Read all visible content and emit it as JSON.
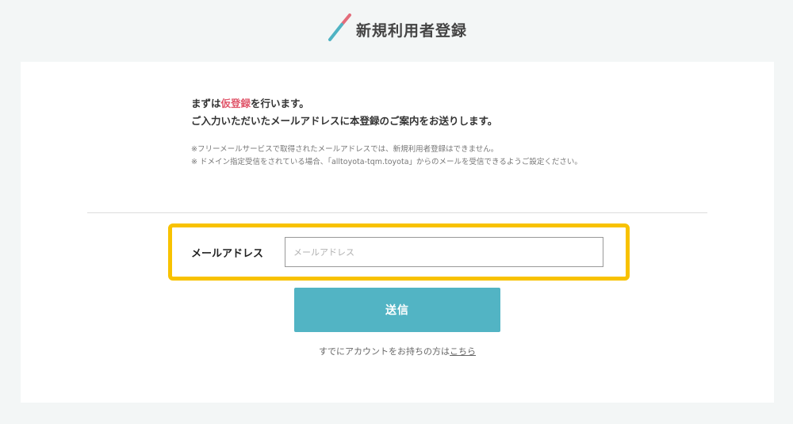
{
  "header": {
    "title": "新規利用者登録",
    "icon": "slash-mark-icon",
    "icon_colors": [
      "#e36c7a",
      "#4fb3c3"
    ]
  },
  "intro": {
    "line1_prefix": "まずは",
    "line1_accent": "仮登録",
    "line1_suffix": "を行います。",
    "line2": "ご入力いただいたメールアドレスに本登録のご案内をお送りします。"
  },
  "notes": [
    "※フリーメールサービスで取得されたメールアドレスでは、新規利用者登録はできません。",
    "※ ドメイン指定受信をされている場合、「alltoyota-tqm.toyota」からのメールを受信できるようご設定ください。"
  ],
  "form": {
    "email_label": "メールアドレス",
    "email_placeholder": "メールアドレス",
    "email_value": "",
    "submit_label": "送信"
  },
  "login": {
    "prefix": "すでにアカウントをお持ちの方は",
    "link_label": "こちら"
  },
  "colors": {
    "accent": "#e0566a",
    "button": "#52b4c4",
    "highlight": "#f8c200",
    "background": "#f3f6f6"
  }
}
